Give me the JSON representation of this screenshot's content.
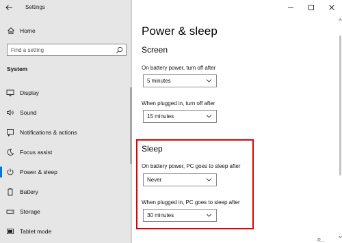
{
  "window": {
    "app_title": "Settings"
  },
  "sidebar": {
    "home_label": "Home",
    "search_placeholder": "Find a setting",
    "section_label": "System",
    "items": [
      {
        "label": "Display",
        "icon": "monitor-icon"
      },
      {
        "label": "Sound",
        "icon": "speaker-icon"
      },
      {
        "label": "Notifications & actions",
        "icon": "notification-icon"
      },
      {
        "label": "Focus assist",
        "icon": "moon-icon"
      },
      {
        "label": "Power & sleep",
        "icon": "power-icon",
        "active": true
      },
      {
        "label": "Battery",
        "icon": "battery-icon"
      },
      {
        "label": "Storage",
        "icon": "storage-icon"
      },
      {
        "label": "Tablet mode",
        "icon": "tablet-icon"
      }
    ]
  },
  "main": {
    "page_title": "Power & sleep",
    "screen": {
      "title": "Screen",
      "battery_label": "On battery power, turn off after",
      "battery_value": "5 minutes",
      "plugged_label": "When plugged in, turn off after",
      "plugged_value": "15 minutes"
    },
    "sleep": {
      "title": "Sleep",
      "battery_label": "On battery power, PC goes to sleep after",
      "battery_value": "Never",
      "plugged_label": "When plugged in, PC goes to sleep after",
      "plugged_value": "30 minutes"
    },
    "cut_off_text": "R..."
  },
  "colors": {
    "accent": "#0078d7",
    "highlight": "#e00000",
    "sidebar_bg": "#e6e6e6"
  }
}
